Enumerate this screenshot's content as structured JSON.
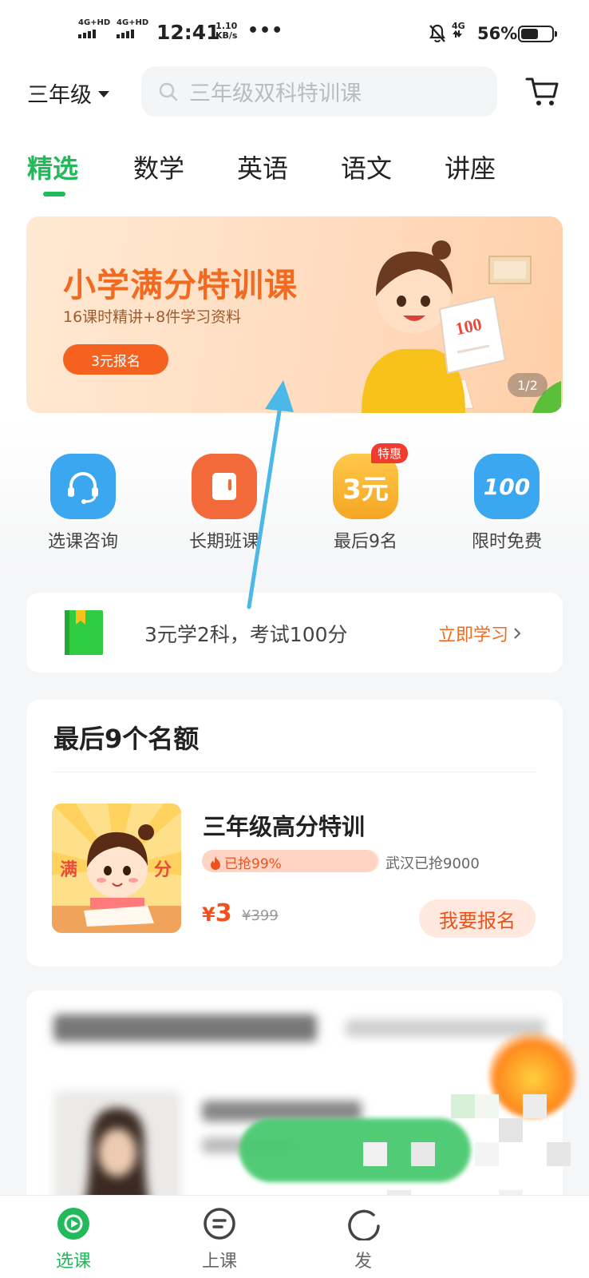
{
  "status_bar": {
    "sim1": "4G+HD",
    "sim2": "4G+HD",
    "time": "12:41",
    "net_speed_value": "1.10",
    "net_speed_unit": "KB/s",
    "more": "•••",
    "network": "4G",
    "battery_percent": "56%",
    "battery_level": 0.56
  },
  "header": {
    "grade_label": "三年级",
    "search_placeholder": "三年级双科特训课",
    "cart_icon": "cart-icon"
  },
  "tabs": [
    {
      "label": "精选",
      "active": true
    },
    {
      "label": "数学",
      "active": false
    },
    {
      "label": "英语",
      "active": false
    },
    {
      "label": "语文",
      "active": false
    },
    {
      "label": "讲座",
      "active": false
    }
  ],
  "banner": {
    "title": "小学满分特训课",
    "subtitle": "16课时精讲+8件学习资料",
    "button": "3元报名",
    "indicator": "1/2"
  },
  "quick_entries": [
    {
      "label": "选课咨询",
      "icon": "headset-icon",
      "color": "#3aa7f0"
    },
    {
      "label": "长期班课",
      "icon": "book-icon",
      "color": "#f26a3a"
    },
    {
      "label": "最后9名",
      "icon": "three-yuan-icon",
      "color": "#f5a623",
      "tag": "特惠",
      "icon_text": "3元"
    },
    {
      "label": "限时免费",
      "icon": "hundred-icon",
      "color": "#3aa7f0",
      "icon_text": "100"
    }
  ],
  "promo": {
    "text": "3元学2科，考试100分",
    "link": "立即学习"
  },
  "course_section": {
    "heading": "最后9个名额",
    "course": {
      "title": "三年级高分特训",
      "sold_label": "已抢99%",
      "sold_fraction": 0.99,
      "city_sold": "武汉已抢9000",
      "currency": "¥",
      "price": "3",
      "original_price": "¥399",
      "enroll_button": "我要报名",
      "thumb_text_left": "满",
      "thumb_text_right": "分"
    }
  },
  "bottom_nav": [
    {
      "label": "选课",
      "icon": "play-icon",
      "active": true
    },
    {
      "label": "上课",
      "icon": "class-icon",
      "active": false
    },
    {
      "label": "发",
      "icon": "discover-icon",
      "active": false
    }
  ],
  "colors": {
    "brand_green": "#21b95a",
    "accent_orange": "#f26a1f",
    "price_red": "#f0501e",
    "annotation_arrow": "#4cb8e8"
  }
}
